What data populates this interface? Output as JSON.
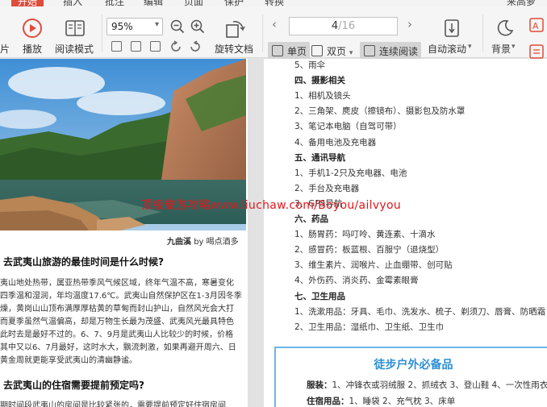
{
  "menu": {
    "items": [
      "开始",
      "插入",
      "批注",
      "编辑",
      "页面",
      "保护",
      "转换"
    ],
    "user": "来高萝"
  },
  "toolbar": {
    "left_partial": "片",
    "play": "播放",
    "read_mode": "阅读模式",
    "zoom_value": "95%",
    "rotate_doc": "旋转文档",
    "page_current": "4",
    "page_total": "/16",
    "single_page": "单页",
    "double_page": "双页",
    "continuous_read": "连续阅读",
    "auto_scroll": "自动滚动",
    "background": "背景"
  },
  "left_page": {
    "caption_title": "九曲溪",
    "caption_by": "by 喝点酒多",
    "heading1": "去武夷山旅游的最佳时间是什么时候?",
    "para1": [
      "夷山地处热带，属亚热带季风气候区域，终年气温不高，寒暑变化",
      "四季温和湿润，年均温度17.6℃。武夷山自然保护区在1-3月因冬季",
      "燥，黄岗山山顶布满厚厚枯黄的草甸而封山护山，自然风光会大打",
      "而夏季虽然气温偏高，却是万物生长最为茂盛、武夷风光最具特色",
      "此时去是最好不过的。6、7、9月是武夷山人比较少的时候，价格",
      "其中又以6、7月最好，这时水大，飘流刺激，如果再避开周六、日",
      "黄金周就更能享受武夷山的清幽静谧。"
    ],
    "heading2": "去武夷山的住宿需要提前预定吗?",
    "para2_partial": "期时间段武夷山的房间是比较紧张的，需要提前预定好住宿房间"
  },
  "right_page": {
    "lines": [
      {
        "t": "5、雨伞",
        "h": false
      },
      {
        "t": "四、摄影相关",
        "h": true
      },
      {
        "t": "1、相机及镜头",
        "h": false
      },
      {
        "t": "2、三角架、麂皮（擦镜布）、摄影包及防水罩",
        "h": false
      },
      {
        "t": "3、笔记本电脑（自驾可带）",
        "h": false
      },
      {
        "t": "4、备用电池及充电器",
        "h": false
      },
      {
        "t": "五、通讯导航",
        "h": true
      },
      {
        "t": "1、手机1-2只及充电器、电池",
        "h": false
      },
      {
        "t": "2、手台及充电器",
        "h": false
      },
      {
        "t": "3、GPS导航",
        "h": false
      },
      {
        "t": "六、药品",
        "h": true
      },
      {
        "t": "1、肠胃药：吗叮呤、黄连素、十滴水",
        "h": false
      },
      {
        "t": "2、感冒药：板蓝根、百服宁（退烧型）",
        "h": false
      },
      {
        "t": "3、维生素片、润喉片、止血绷带、创可贴",
        "h": false
      },
      {
        "t": "4、外伤药、消炎药、金霉素眼膏",
        "h": false
      },
      {
        "t": "七、卫生用品",
        "h": true
      },
      {
        "t": "1、洗漱用品：牙具、毛巾、洗发水、梳子、剃须刀、唇膏、防晒霜",
        "h": false
      },
      {
        "t": "2、卫生用品：湿纸巾、卫生纸、卫生巾",
        "h": false
      }
    ],
    "box_title": "徒步户外必备品",
    "box_clothing_label": "服装：",
    "box_clothing": "1、冲锋衣或羽绒服 2、抓绒衣 3、登山鞋 4、一次性雨衣",
    "box_lodging_label": "住宿用品：",
    "box_lodging": "1、睡袋 2、充气枕 3、床单"
  },
  "watermark": "顶级旅游攻略www.liuchaw.com/Boyou/ailvyou",
  "colors": {
    "accent": "#e04b3c",
    "box_border": "#6db5e6",
    "box_title": "#2b8fd6",
    "watermark": "#e0181c"
  }
}
